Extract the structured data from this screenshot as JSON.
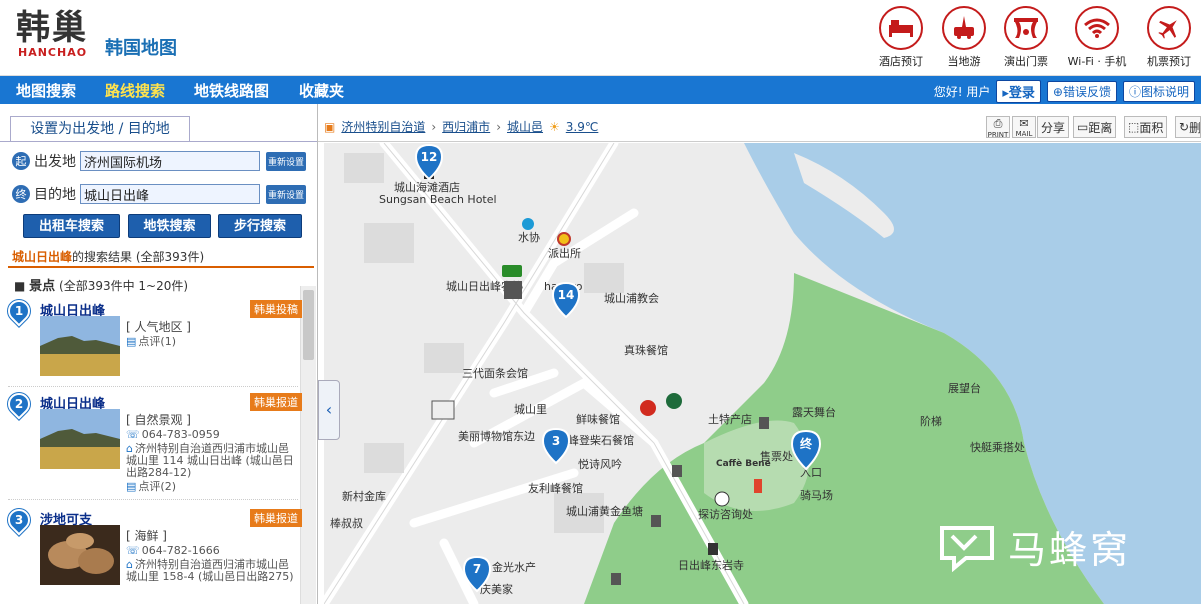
{
  "header": {
    "logo_cn": "韩巢",
    "logo_en": "HANCHAO",
    "site_title": "韩国地图",
    "top_icons": [
      {
        "label": "酒店预订",
        "icon": "bed-icon"
      },
      {
        "label": "当地游",
        "icon": "bus-tour-icon"
      },
      {
        "label": "演出门票",
        "icon": "theater-icon"
      },
      {
        "label": "Wi-Fi · 手机",
        "icon": "wifi-icon"
      },
      {
        "label": "机票预订",
        "icon": "airplane-icon"
      }
    ]
  },
  "nav": {
    "items": [
      "地图搜索",
      "路线搜索",
      "地铁线路图",
      "收藏夹"
    ],
    "active_index": 1,
    "greeting": "您好! 用户",
    "login": "登录",
    "feedback": "错误反馈",
    "legend": "图标说明"
  },
  "left": {
    "tab": "设置为出发地 / 目的地",
    "start_badge": "起",
    "start_label": "出发地",
    "start_value": "济州国际机场",
    "end_badge": "终",
    "end_label": "目的地",
    "end_value": "城山日出峰",
    "reset": "重新设置",
    "buttons": [
      "出租车搜索",
      "地铁搜索",
      "步行搜索"
    ],
    "result_keyword": "城山日出峰",
    "result_suffix": "的搜索结果",
    "result_total": "(全部393件)",
    "category_name": "景点",
    "category_range": "(全部393件中 1~20件)",
    "results": [
      {
        "num": "1",
        "name": "城山日出峰",
        "tag": "韩巢投稿",
        "category": "[ 人气地区 ]",
        "phone": "",
        "address": "",
        "reviews": "点评(1)"
      },
      {
        "num": "2",
        "name": "城山日出峰",
        "tag": "韩巢报道",
        "category": "[ 自然景观 ]",
        "phone": "064-783-0959",
        "address": "济州特别自治道西归浦市城山邑城山里 114 城山日出峰 (城山邑日出路284-12)",
        "reviews": "点评(2)"
      },
      {
        "num": "3",
        "name": "涉地可支 ",
        "tag": "韩巢报道",
        "category": "[ 海鲜 ]",
        "phone": "064-782-1666",
        "address": "济州特别自治道西归浦市城山邑城山里 158-4 (城山邑日出路275)",
        "reviews": ""
      }
    ]
  },
  "mapbar": {
    "crumbs": [
      "济州特别自治道",
      "西归浦市",
      "城山邑"
    ],
    "weather": "3.9℃",
    "tools": [
      "PRINT",
      "MAIL",
      "分享",
      "距离",
      "面积",
      "删"
    ]
  },
  "map": {
    "labels": [
      "城山海滩酒店",
      "Sungsan Beach Hotel",
      "水协",
      "派出所",
      "城山日出峰农协",
      "hanaro",
      "城山浦教会",
      "真珠餐馆",
      "三代面条会馆",
      "城山里",
      "鲜味餐馆",
      "美丽博物馆东边",
      "峰登柴石餐馆",
      "悦诗风吟",
      "新村金库",
      "友利峰餐馆",
      "城山浦黄金鱼塘",
      "棒叔叔",
      "金光水产",
      "庆美家",
      "土特产店",
      "露天舞台",
      "展望台",
      "阶梯",
      "快艇乘搭处",
      "售票处",
      "入口",
      "骑马场",
      "探访咨询处",
      "日出峰东岩寺",
      "Caffè Bene"
    ],
    "markers": [
      "12",
      "14",
      "3",
      "7",
      "终"
    ]
  },
  "watermark": "马蜂窝",
  "colors": {
    "nav_blue": "#1976d2",
    "accent_orange": "#e77b1a",
    "brand_red": "#c41b1b",
    "sea": "#a9cde8",
    "park": "#8fcd8a"
  }
}
